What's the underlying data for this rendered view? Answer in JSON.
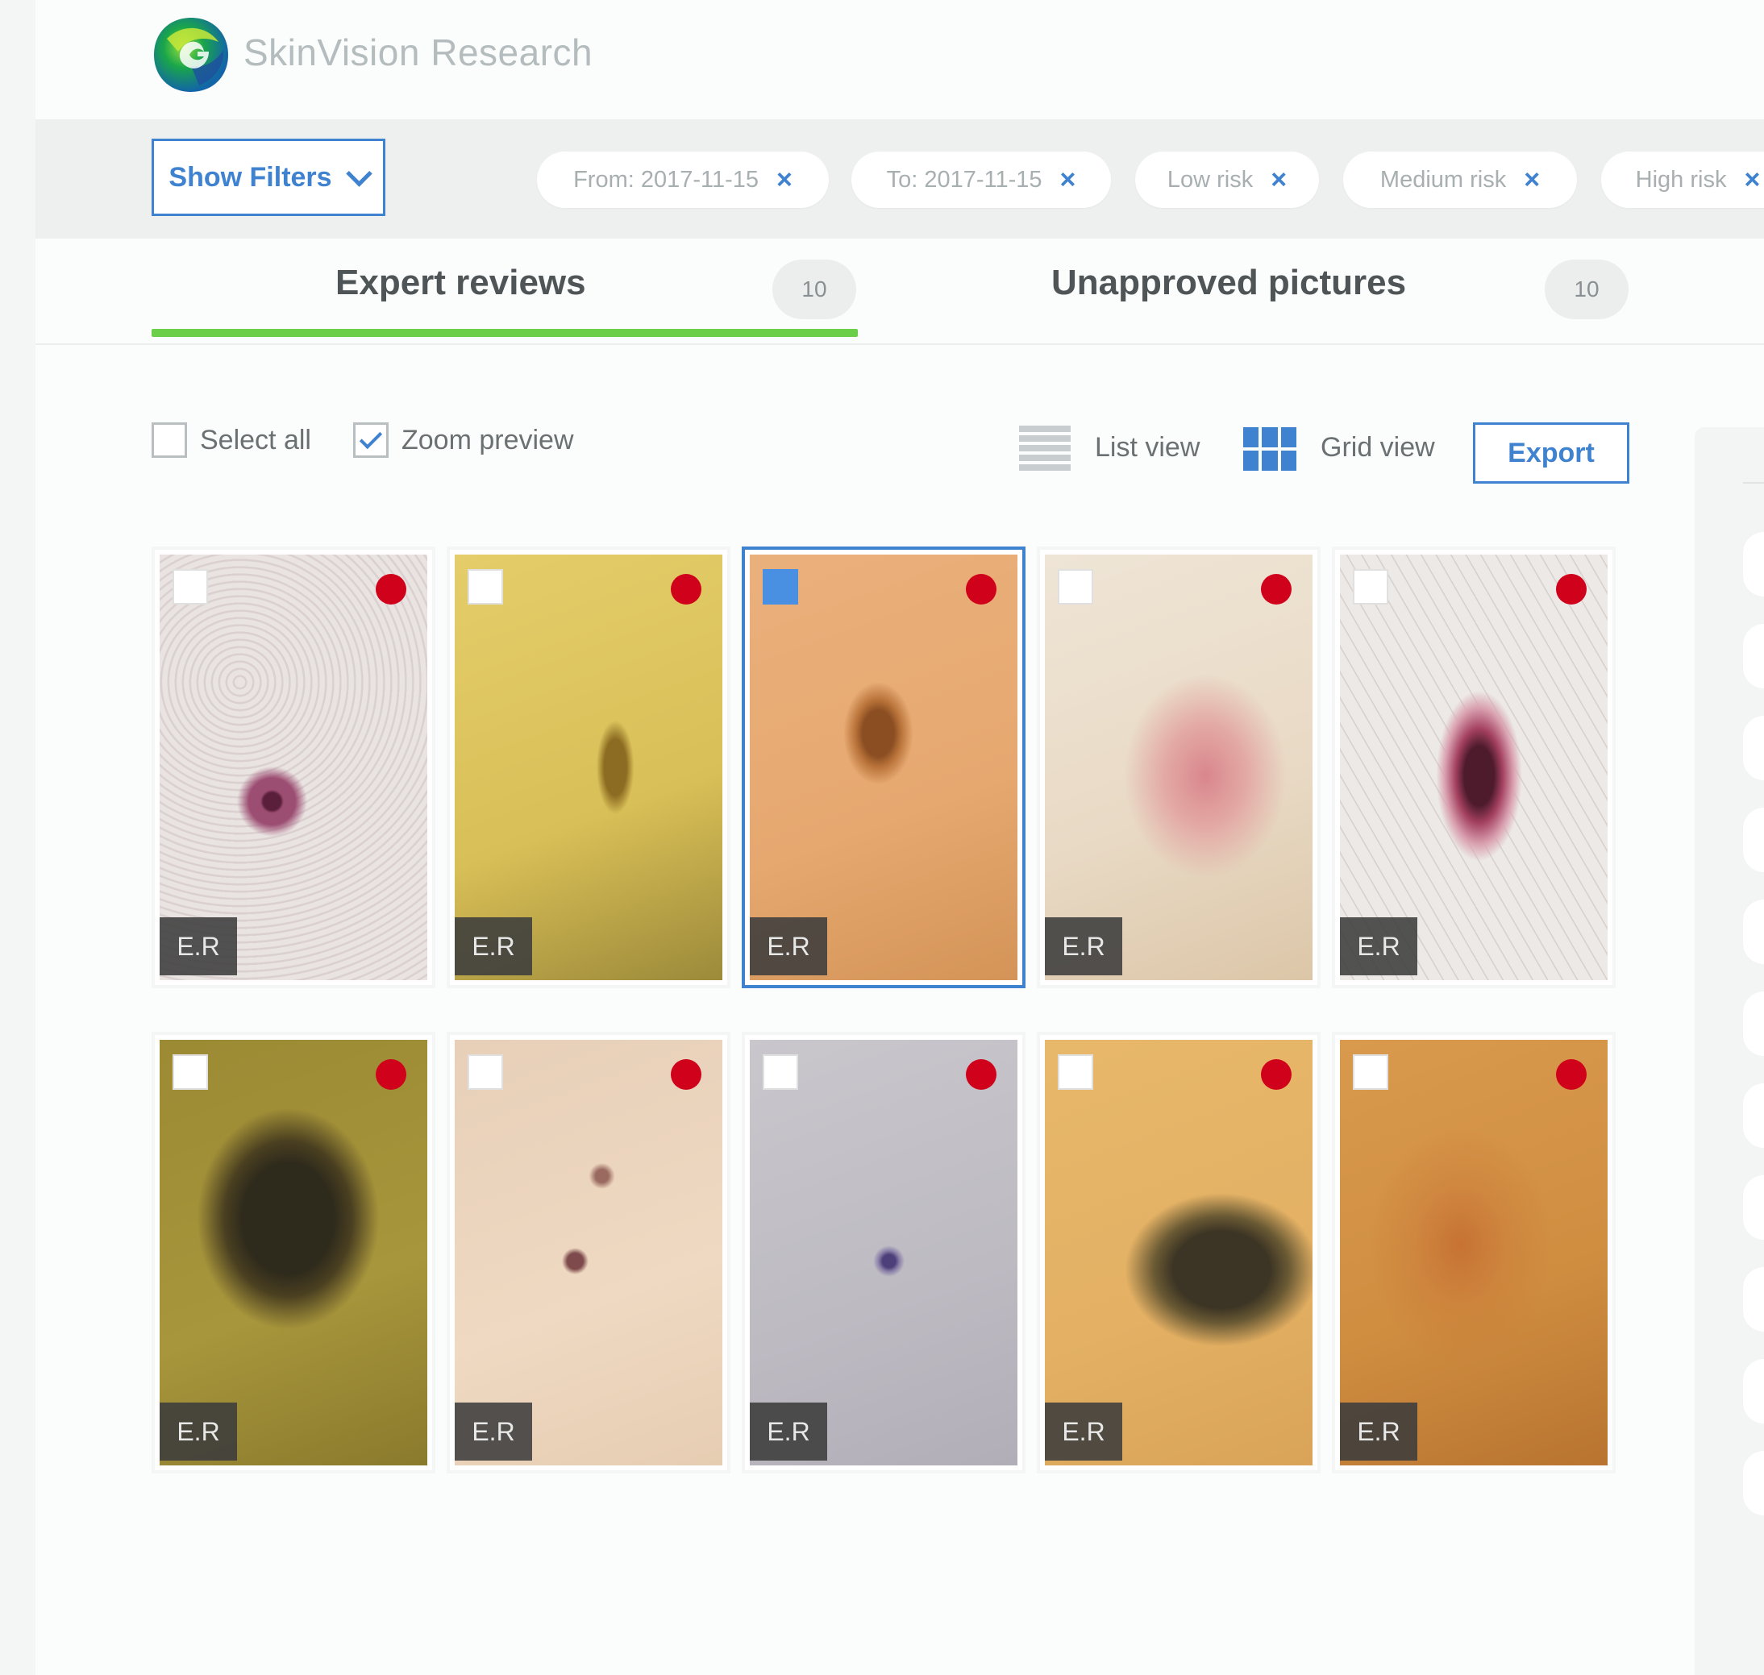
{
  "header": {
    "brand": "SkinVision Research"
  },
  "filters": {
    "show_filters_label": "Show Filters",
    "chips": [
      {
        "label": "From: 2017-11-15"
      },
      {
        "label": "To: 2017-11-15"
      },
      {
        "label": "Low risk"
      },
      {
        "label": "Medium risk"
      },
      {
        "label": "High risk"
      }
    ]
  },
  "tabs": [
    {
      "label": "Expert reviews",
      "count": "10",
      "active": true
    },
    {
      "label": "Unapproved pictures",
      "count": "10",
      "active": false
    }
  ],
  "toolbar": {
    "select_all": "Select all",
    "select_all_checked": false,
    "zoom_preview": "Zoom preview",
    "zoom_preview_checked": true,
    "list_view": "List view",
    "grid_view": "Grid view",
    "active_view": "grid",
    "export": "Export"
  },
  "colors": {
    "accent": "#3f82cf",
    "tab_underline": "#6ccf4a",
    "risk_dot": "#d0021b"
  },
  "tiles": [
    {
      "badge": "E.R",
      "selected": false
    },
    {
      "badge": "E.R",
      "selected": false
    },
    {
      "badge": "E.R",
      "selected": true
    },
    {
      "badge": "E.R",
      "selected": false
    },
    {
      "badge": "E.R",
      "selected": false
    },
    {
      "badge": "E.R",
      "selected": false
    },
    {
      "badge": "E.R",
      "selected": false
    },
    {
      "badge": "E.R",
      "selected": false
    },
    {
      "badge": "E.R",
      "selected": false
    },
    {
      "badge": "E.R",
      "selected": false
    }
  ]
}
